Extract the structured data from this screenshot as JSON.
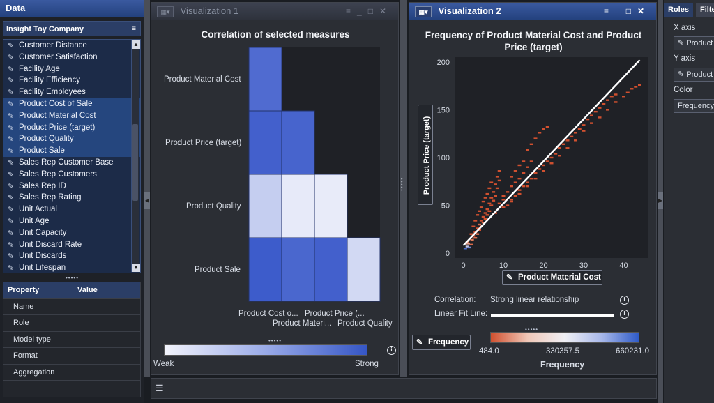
{
  "data_panel": {
    "title": "Data",
    "data_source": "Insight Toy Company",
    "items": [
      {
        "label": "Customer Distance",
        "selected": false
      },
      {
        "label": "Customer Satisfaction",
        "selected": false
      },
      {
        "label": "Facility Age",
        "selected": false
      },
      {
        "label": "Facility Efficiency",
        "selected": false
      },
      {
        "label": "Facility Employees",
        "selected": false
      },
      {
        "label": "Product Cost of Sale",
        "selected": true
      },
      {
        "label": "Product Material Cost",
        "selected": true
      },
      {
        "label": "Product Price (target)",
        "selected": true
      },
      {
        "label": "Product Quality",
        "selected": true
      },
      {
        "label": "Product Sale",
        "selected": true
      },
      {
        "label": "Sales Rep Customer Base",
        "selected": false
      },
      {
        "label": "Sales Rep Customers",
        "selected": false
      },
      {
        "label": "Sales Rep ID",
        "selected": false
      },
      {
        "label": "Sales Rep Rating",
        "selected": false
      },
      {
        "label": "Unit Actual",
        "selected": false
      },
      {
        "label": "Unit Age",
        "selected": false
      },
      {
        "label": "Unit Capacity",
        "selected": false
      },
      {
        "label": "Unit Discard Rate",
        "selected": false
      },
      {
        "label": "Unit Discards",
        "selected": false
      },
      {
        "label": "Unit Lifespan",
        "selected": false
      }
    ],
    "property_table": {
      "headers": [
        "Property",
        "Value"
      ],
      "rows": [
        "Name",
        "Role",
        "Model type",
        "Format",
        "Aggregation"
      ]
    }
  },
  "vis1": {
    "tab_title": "Visualization 1",
    "chart_title": "Correlation of selected measures",
    "row_labels": [
      "Product Material Cost",
      "Product Price (target)",
      "Product Quality",
      "Product Sale"
    ],
    "col_labels_top": [
      "Product Cost o...",
      "Product Price (..."
    ],
    "col_labels_bottom": [
      "Product Materi...",
      "Product Quality"
    ],
    "legend_min": "Weak",
    "legend_max": "Strong"
  },
  "vis2": {
    "tab_title": "Visualization 2",
    "chart_title": "Frequency of Product Material Cost and Product Price (target)",
    "x_axis_button": "Product Material Cost",
    "y_axis_button": "Product Price (target)",
    "correlation_label": "Correlation:",
    "correlation_value": "Strong linear relationship",
    "fit_label": "Linear Fit Line:",
    "frequency_button": "Frequency",
    "legend_ticks": [
      "484.0",
      "330357.5",
      "660231.0"
    ],
    "legend_title": "Frequency"
  },
  "roles_panel": {
    "tab_roles": "Roles",
    "tab_filters": "Filte",
    "x_axis_label": "X axis",
    "x_axis_value": "Product",
    "y_axis_label": "Y axis",
    "y_axis_value": "Product",
    "color_label": "Color",
    "color_value": "Frequency"
  },
  "colors": {
    "accent": "#2b4a8e",
    "heat_strong": "#3a58c8",
    "heat_weak": "#eef0fb",
    "freq_low": "#d0502f",
    "freq_high": "#2f5bc8"
  },
  "chart_data": [
    {
      "type": "heatmap",
      "title": "Correlation of selected measures",
      "rows": [
        "Product Material Cost",
        "Product Price (target)",
        "Product Quality",
        "Product Sale"
      ],
      "columns": [
        "Product Cost of Sale",
        "Product Material Cost",
        "Product Price (target)",
        "Product Quality"
      ],
      "values": [
        [
          0.85,
          null,
          null,
          null
        ],
        [
          0.92,
          0.9,
          null,
          null
        ],
        [
          0.22,
          0.04,
          0.03,
          null
        ],
        [
          0.95,
          0.88,
          0.92,
          0.15
        ]
      ],
      "legend": {
        "min_label": "Weak",
        "max_label": "Strong"
      }
    },
    {
      "type": "scatter",
      "title": "Frequency of Product Material Cost and Product Price (target)",
      "xlabel": "Product Material Cost",
      "ylabel": "Product Price (target)",
      "xlim": [
        -2,
        46
      ],
      "ylim": [
        -5,
        205
      ],
      "xticks": [
        0,
        10,
        20,
        30,
        40
      ],
      "yticks": [
        0,
        50,
        100,
        150,
        200
      ],
      "fit_line": {
        "x": [
          0,
          44
        ],
        "y": [
          8,
          202
        ]
      },
      "color_scale": {
        "min": 484.0,
        "mid": 330357.5,
        "max": 660231.0,
        "label": "Frequency"
      },
      "points": [
        [
          0.5,
          5,
          "#4a6fd0"
        ],
        [
          1,
          7,
          "#c9c9e6"
        ],
        [
          1.2,
          10,
          "#e0a090"
        ],
        [
          1.5,
          6,
          "#6f86d8"
        ],
        [
          2,
          9,
          "#d86a4a"
        ],
        [
          1,
          12,
          "#d86a4a"
        ],
        [
          2.2,
          14,
          "#e07a58"
        ],
        [
          2.5,
          18,
          "#d0502f"
        ],
        [
          3,
          16,
          "#d86a4a"
        ],
        [
          3,
          22,
          "#d0502f"
        ],
        [
          3.5,
          20,
          "#d86a4a"
        ],
        [
          3.5,
          26,
          "#d0502f"
        ],
        [
          4,
          24,
          "#d0502f"
        ],
        [
          4,
          30,
          "#d86a4a"
        ],
        [
          4.5,
          28,
          "#d0502f"
        ],
        [
          4.5,
          34,
          "#d0502f"
        ],
        [
          5,
          32,
          "#d86a4a"
        ],
        [
          5,
          38,
          "#d0502f"
        ],
        [
          5.5,
          36,
          "#d0502f"
        ],
        [
          5.5,
          42,
          "#d0502f"
        ],
        [
          6,
          40,
          "#d0502f"
        ],
        [
          6,
          46,
          "#d0502f"
        ],
        [
          6.5,
          44,
          "#d0502f"
        ],
        [
          6.5,
          52,
          "#d0502f"
        ],
        [
          7,
          50,
          "#d0502f"
        ],
        [
          7,
          58,
          "#d0502f"
        ],
        [
          7.5,
          55,
          "#d0502f"
        ],
        [
          7.5,
          64,
          "#d0502f"
        ],
        [
          8,
          60,
          "#d0502f"
        ],
        [
          8,
          72,
          "#d0502f"
        ],
        [
          8.5,
          68,
          "#d0502f"
        ],
        [
          8.5,
          80,
          "#d0502f"
        ],
        [
          9,
          76,
          "#d0502f"
        ],
        [
          9,
          86,
          "#d0502f"
        ],
        [
          2,
          20,
          "#d0502f"
        ],
        [
          2.5,
          28,
          "#d0502f"
        ],
        [
          3,
          34,
          "#d0502f"
        ],
        [
          3.5,
          40,
          "#d0502f"
        ],
        [
          4,
          44,
          "#d0502f"
        ],
        [
          4.5,
          48,
          "#d0502f"
        ],
        [
          5,
          54,
          "#d0502f"
        ],
        [
          5.5,
          58,
          "#d0502f"
        ],
        [
          6,
          62,
          "#d0502f"
        ],
        [
          6.5,
          68,
          "#d0502f"
        ],
        [
          7,
          74,
          "#d0502f"
        ],
        [
          10,
          60,
          "#d0502f"
        ],
        [
          11,
          64,
          "#d0502f"
        ],
        [
          12,
          70,
          "#d0502f"
        ],
        [
          13,
          74,
          "#d0502f"
        ],
        [
          14,
          78,
          "#d0502f"
        ],
        [
          15,
          84,
          "#d0502f"
        ],
        [
          16,
          90,
          "#d0502f"
        ],
        [
          17,
          96,
          "#d0502f"
        ],
        [
          16,
          108,
          "#d0502f"
        ],
        [
          17,
          114,
          "#d0502f"
        ],
        [
          18,
          120,
          "#d0502f"
        ],
        [
          19,
          126,
          "#d0502f"
        ],
        [
          20,
          130,
          "#d0502f"
        ],
        [
          21,
          132,
          "#d0502f"
        ],
        [
          12,
          80,
          "#d0502f"
        ],
        [
          13,
          86,
          "#d0502f"
        ],
        [
          14,
          92,
          "#d0502f"
        ],
        [
          15,
          96,
          "#d0502f"
        ],
        [
          9,
          52,
          "#d0502f"
        ],
        [
          10,
          56,
          "#d0502f"
        ],
        [
          11,
          50,
          "#d0502f"
        ],
        [
          12,
          56,
          "#d0502f"
        ],
        [
          13,
          60,
          "#d0502f"
        ],
        [
          14,
          66,
          "#d0502f"
        ],
        [
          15,
          70,
          "#d0502f"
        ],
        [
          16,
          74,
          "#d0502f"
        ],
        [
          17,
          78,
          "#d0502f"
        ],
        [
          18,
          84,
          "#d0502f"
        ],
        [
          19,
          88,
          "#d0502f"
        ],
        [
          20,
          92,
          "#d0502f"
        ],
        [
          21,
          96,
          "#d0502f"
        ],
        [
          22,
          100,
          "#d0502f"
        ],
        [
          23,
          104,
          "#d0502f"
        ],
        [
          24,
          110,
          "#d0502f"
        ],
        [
          25,
          114,
          "#d0502f"
        ],
        [
          26,
          118,
          "#d0502f"
        ],
        [
          27,
          122,
          "#d0502f"
        ],
        [
          28,
          126,
          "#d0502f"
        ],
        [
          29,
          130,
          "#d0502f"
        ],
        [
          30,
          134,
          "#d0502f"
        ],
        [
          31,
          140,
          "#d0502f"
        ],
        [
          32,
          144,
          "#d0502f"
        ],
        [
          33,
          148,
          "#d0502f"
        ],
        [
          34,
          152,
          "#d0502f"
        ],
        [
          35,
          156,
          "#d0502f"
        ],
        [
          36,
          160,
          "#d0502f"
        ],
        [
          37,
          164,
          "#d0502f"
        ],
        [
          38,
          166,
          "#d0502f"
        ],
        [
          40,
          164,
          "#d0502f"
        ],
        [
          41,
          168,
          "#d0502f"
        ],
        [
          42,
          172,
          "#d0502f"
        ],
        [
          43,
          174,
          "#d0502f"
        ],
        [
          44,
          176,
          "#d0502f"
        ],
        [
          38,
          158,
          "#d0502f"
        ],
        [
          36,
          150,
          "#d0502f"
        ],
        [
          34,
          142,
          "#d0502f"
        ],
        [
          32,
          136,
          "#d0502f"
        ],
        [
          30,
          128,
          "#d0502f"
        ],
        [
          28,
          118,
          "#d0502f"
        ],
        [
          26,
          110,
          "#d0502f"
        ],
        [
          24,
          102,
          "#d0502f"
        ],
        [
          22,
          94,
          "#d0502f"
        ],
        [
          20,
          86,
          "#d0502f"
        ],
        [
          18,
          78,
          "#d0502f"
        ],
        [
          16,
          70,
          "#d0502f"
        ],
        [
          14,
          62,
          "#d0502f"
        ],
        [
          12,
          54,
          "#d0502f"
        ],
        [
          10,
          48,
          "#d0502f"
        ],
        [
          8,
          42,
          "#d0502f"
        ]
      ]
    },
    {
      "type": "table",
      "title": "Frequency",
      "gradient": [
        "#d0502f",
        "#f0f0f5",
        "#2f5bc8"
      ],
      "ticks": [
        484.0,
        330357.5,
        660231.0
      ]
    }
  ]
}
